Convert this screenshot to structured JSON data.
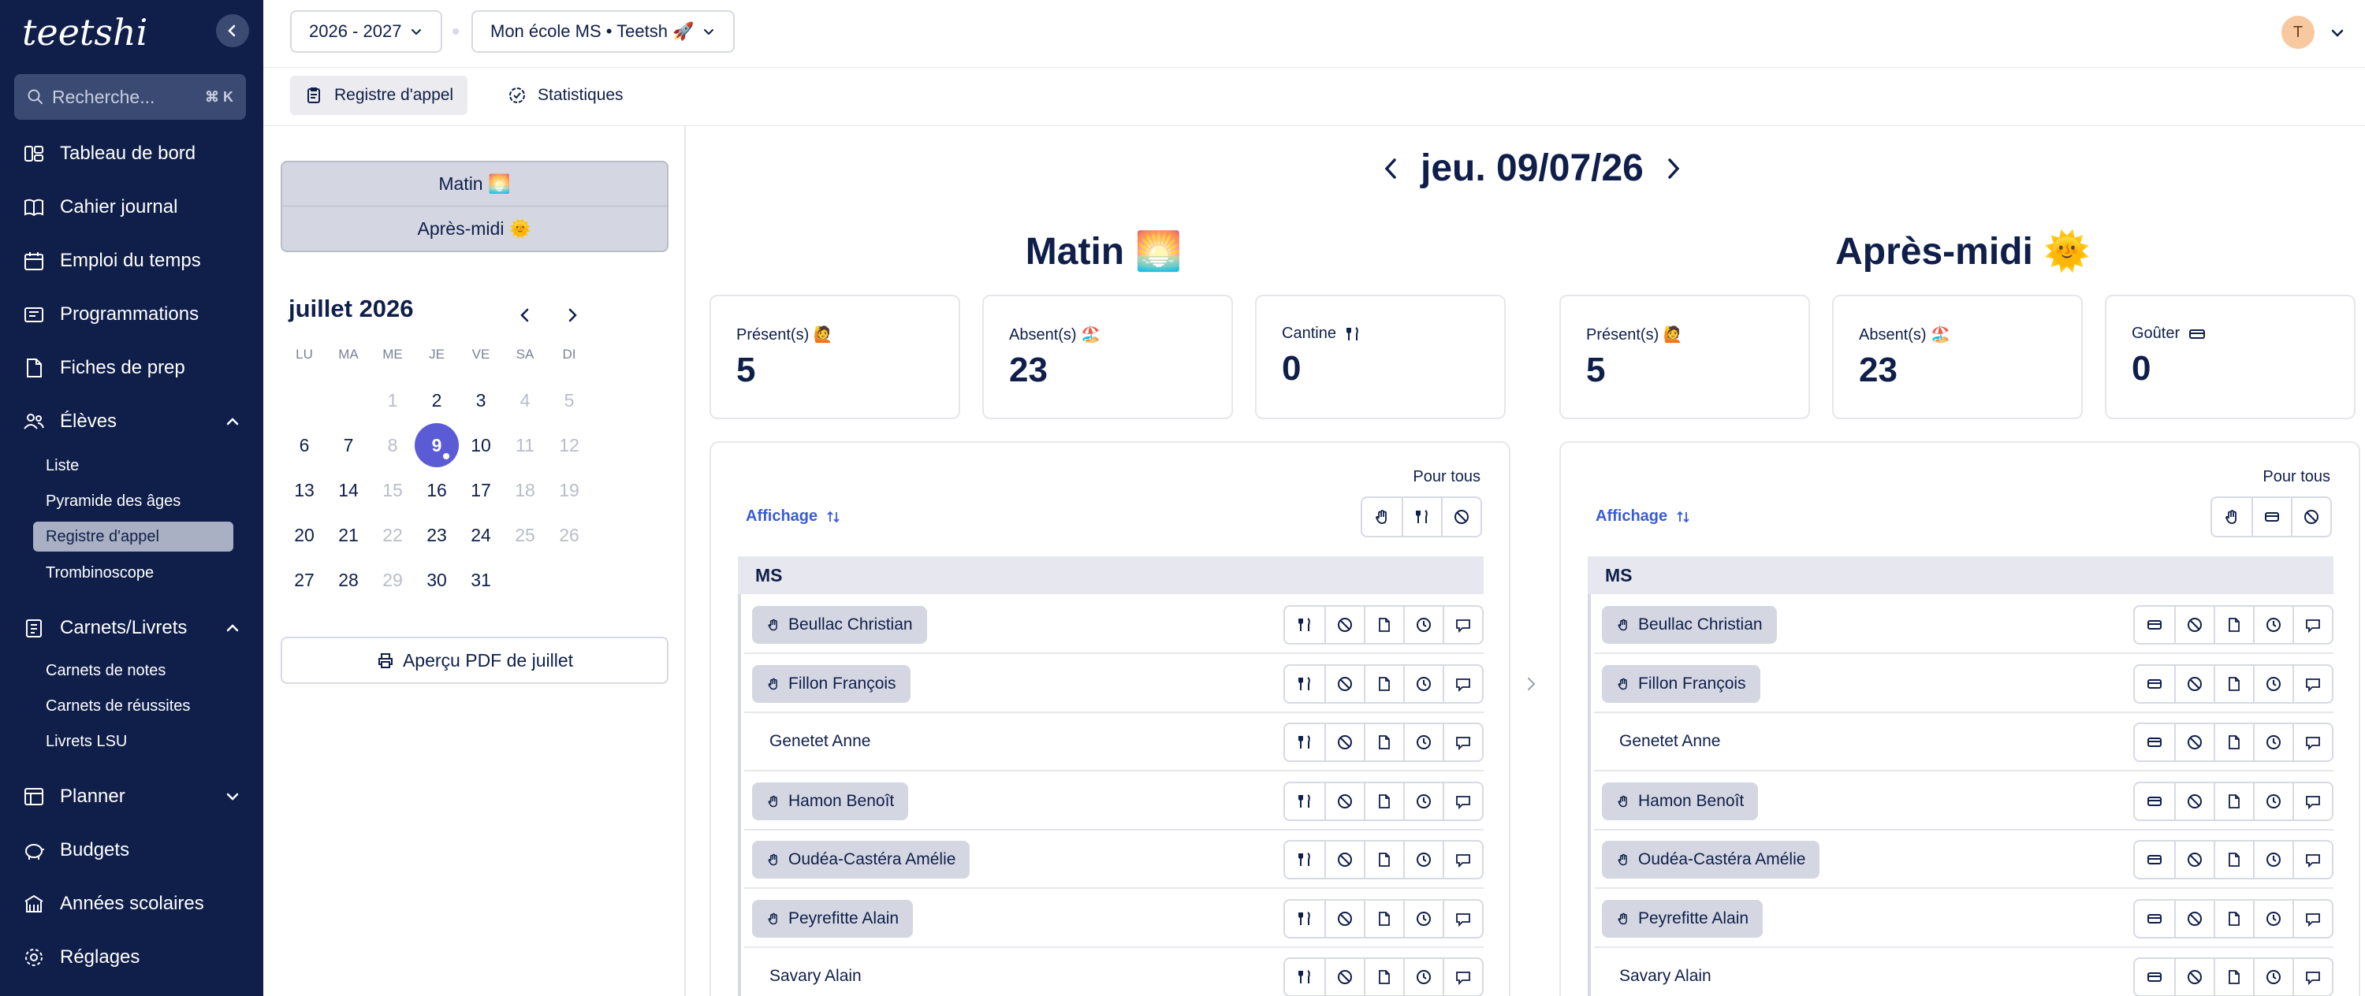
{
  "sidebar": {
    "logo": "teetshi",
    "search_placeholder": "Recherche...",
    "search_shortcut": "⌘ K",
    "items": [
      {
        "label": "Tableau de bord",
        "icon": "dashboard-icon"
      },
      {
        "label": "Cahier journal",
        "icon": "book-icon"
      },
      {
        "label": "Emploi du temps",
        "icon": "calendar-icon"
      },
      {
        "label": "Programmations",
        "icon": "programmations-icon"
      },
      {
        "label": "Fiches de prep",
        "icon": "document-icon"
      },
      {
        "label": "Élèves",
        "icon": "users-icon"
      },
      {
        "label": "Carnets/Livrets",
        "icon": "notebook-icon"
      },
      {
        "label": "Planner",
        "icon": "planner-icon"
      },
      {
        "label": "Budgets",
        "icon": "piggy-bank-icon"
      },
      {
        "label": "Années scolaires",
        "icon": "school-icon"
      },
      {
        "label": "Réglages",
        "icon": "gear-icon"
      }
    ],
    "eleves_sub": [
      "Liste",
      "Pyramide des âges",
      "Registre d'appel",
      "Trombinoscope"
    ],
    "carnets_sub": [
      "Carnets de notes",
      "Carnets de réussites",
      "Livrets LSU"
    ]
  },
  "topbar": {
    "year": "2026 - 2027",
    "school": "Mon école MS • Teetsh 🚀",
    "avatar": "T"
  },
  "tabs": [
    "Registre d'appel",
    "Statistiques"
  ],
  "left": {
    "shifts": [
      "Matin 🌅",
      "Après-midi 🌞"
    ],
    "month": "juillet 2026",
    "weekdays": [
      "LU",
      "MA",
      "ME",
      "JE",
      "VE",
      "SA",
      "DI"
    ],
    "weeks": [
      [
        "",
        "",
        "1",
        "2",
        "3",
        "4",
        "5"
      ],
      [
        "6",
        "7",
        "8",
        "9",
        "10",
        "11",
        "12"
      ],
      [
        "13",
        "14",
        "15",
        "16",
        "17",
        "18",
        "19"
      ],
      [
        "20",
        "21",
        "22",
        "23",
        "24",
        "25",
        "26"
      ],
      [
        "27",
        "28",
        "29",
        "30",
        "31",
        "",
        ""
      ]
    ],
    "selected_day": "9",
    "pdf_button": "Aperçu PDF de juillet"
  },
  "date": "jeu. 09/07/26",
  "matin": {
    "title": "Matin 🌅",
    "cards": [
      {
        "label": "Présent(s) 🙋",
        "value": "5"
      },
      {
        "label": "Absent(s) 🏖️",
        "value": "23"
      },
      {
        "label": "Cantine",
        "value": "0"
      }
    ]
  },
  "apresmidi": {
    "title": "Après-midi 🌞",
    "cards": [
      {
        "label": "Présent(s) 🙋",
        "value": "5"
      },
      {
        "label": "Absent(s) 🏖️",
        "value": "23"
      },
      {
        "label": "Goûter",
        "value": "0"
      }
    ]
  },
  "panel": {
    "pour_tous": "Pour tous",
    "affichage": "Affichage",
    "group": "MS",
    "students": [
      {
        "name": "Beullac Christian",
        "present": true
      },
      {
        "name": "Fillon François",
        "present": true
      },
      {
        "name": "Genetet Anne",
        "present": false
      },
      {
        "name": "Hamon Benoît",
        "present": true
      },
      {
        "name": "Oudéa-Castéra Amélie",
        "present": true
      },
      {
        "name": "Peyrefitte Alain",
        "present": true
      },
      {
        "name": "Savary Alain",
        "present": false
      }
    ]
  }
}
